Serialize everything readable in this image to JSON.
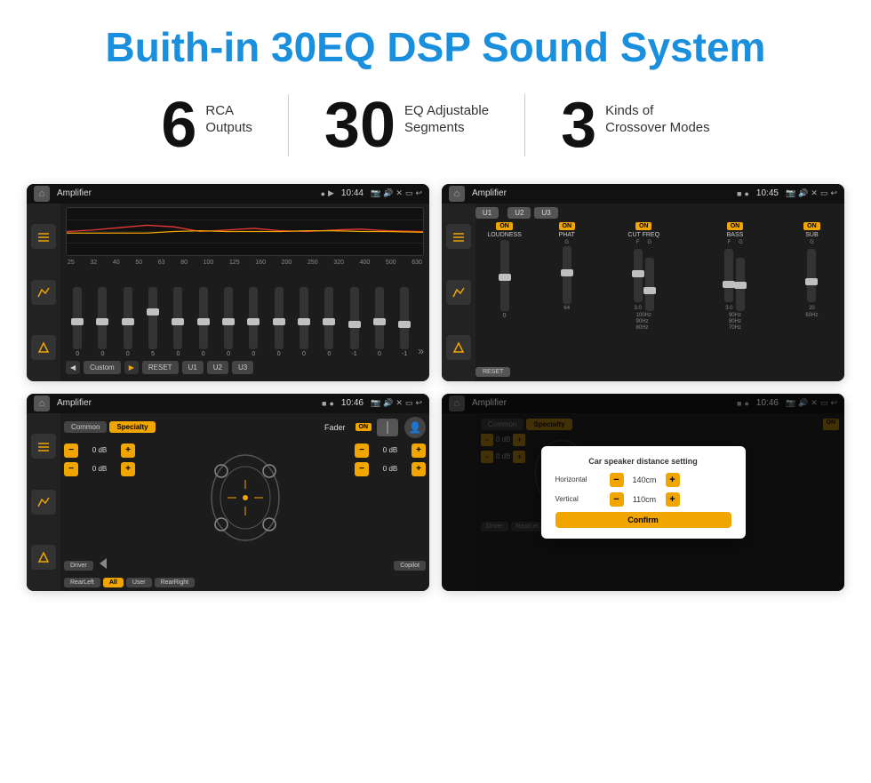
{
  "header": {
    "title": "Buith-in 30EQ DSP Sound System"
  },
  "stats": [
    {
      "number": "6",
      "line1": "RCA",
      "line2": "Outputs"
    },
    {
      "number": "30",
      "line1": "EQ Adjustable",
      "line2": "Segments"
    },
    {
      "number": "3",
      "line1": "Kinds of",
      "line2": "Crossover Modes"
    }
  ],
  "screens": {
    "screen1": {
      "app_name": "Amplifier",
      "time": "10:44",
      "eq_frequencies": [
        "25",
        "32",
        "40",
        "50",
        "63",
        "80",
        "100",
        "125",
        "160",
        "200",
        "250",
        "320",
        "400",
        "500",
        "630"
      ],
      "eq_values": [
        "0",
        "0",
        "0",
        "5",
        "0",
        "0",
        "0",
        "0",
        "0",
        "0",
        "0",
        "-1",
        "0",
        "-1"
      ],
      "preset_label": "Custom",
      "buttons": [
        "RESET",
        "U1",
        "U2",
        "U3"
      ]
    },
    "screen2": {
      "app_name": "Amplifier",
      "time": "10:45",
      "channels": [
        "U1",
        "U2",
        "U3"
      ],
      "controls": [
        "LOUDNESS",
        "PHAT",
        "CUT FREQ",
        "BASS",
        "SUB"
      ],
      "reset_label": "RESET"
    },
    "screen3": {
      "app_name": "Amplifier",
      "time": "10:46",
      "tabs": [
        "Common",
        "Specialty"
      ],
      "fader_label": "Fader",
      "on_label": "ON",
      "db_values": [
        "0 dB",
        "0 dB",
        "0 dB",
        "0 dB"
      ],
      "bottom_buttons": [
        "Driver",
        "RearLeft",
        "All",
        "User",
        "RearRight",
        "Copilot"
      ]
    },
    "screen4": {
      "app_name": "Amplifier",
      "time": "10:46",
      "dialog": {
        "title": "Car speaker distance setting",
        "horizontal_label": "Horizontal",
        "horizontal_value": "140cm",
        "vertical_label": "Vertical",
        "vertical_value": "110cm",
        "confirm_label": "Confirm"
      }
    }
  },
  "icons": {
    "home": "⌂",
    "back": "↩",
    "play": "▶",
    "pause": "▮▮",
    "prev": "◀",
    "next": "▶▶",
    "volume": "🔊",
    "location": "📍",
    "camera": "📷",
    "settings": "⚙"
  }
}
